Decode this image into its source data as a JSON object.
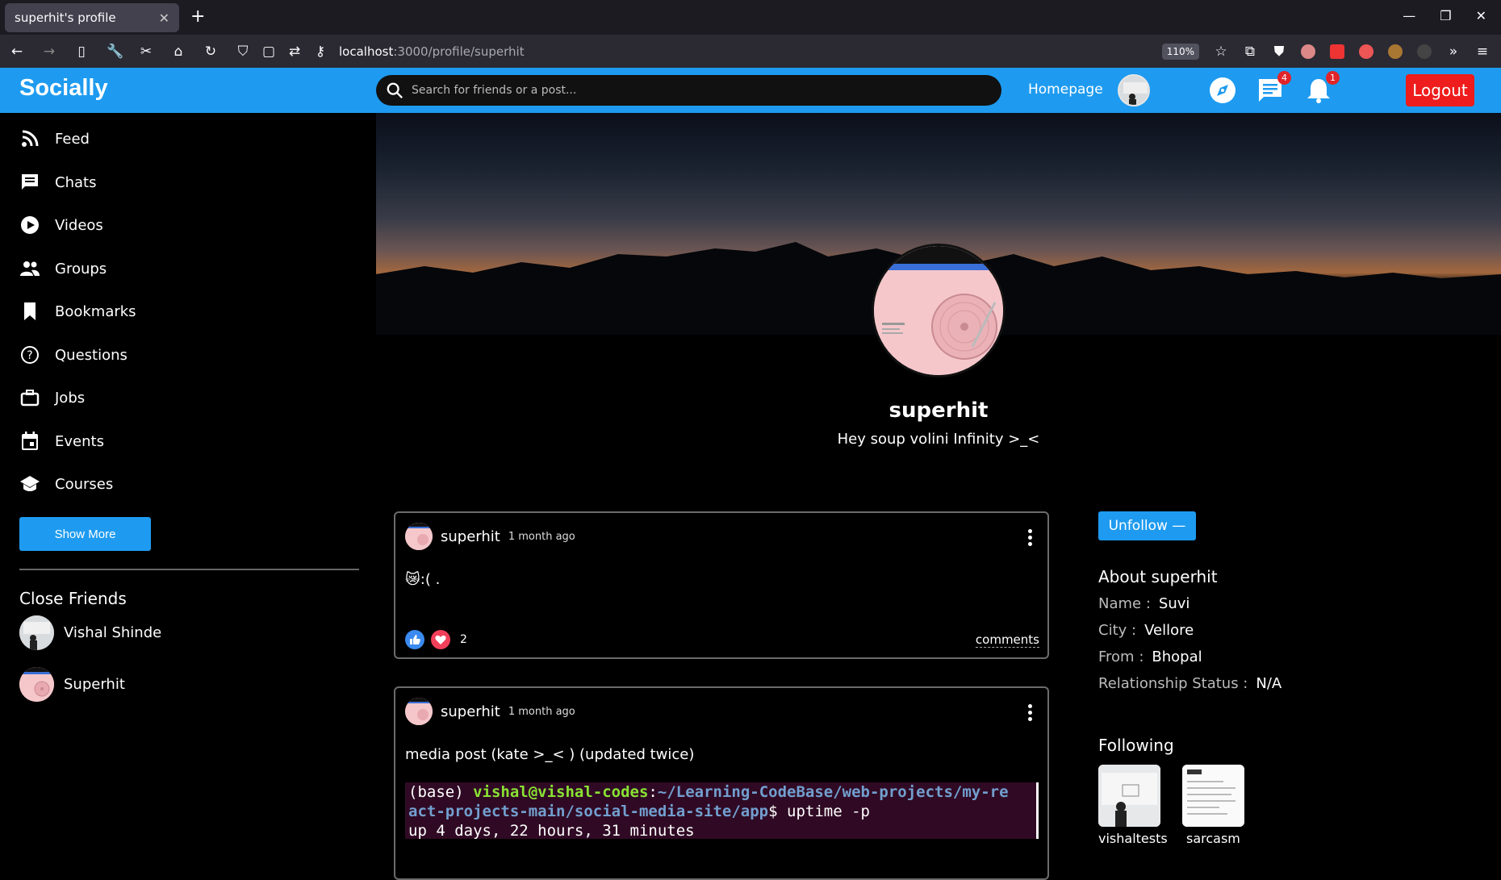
{
  "browser": {
    "tab_title": "superhit's profile",
    "url_host": "localhost",
    "url_path": ":3000/profile/superhit",
    "zoom": "110%"
  },
  "header": {
    "logo": "Socially",
    "search_placeholder": "Search for friends or a post...",
    "homepage_label": "Homepage",
    "messages_badge": "4",
    "notifications_badge": "1",
    "logout_label": "Logout"
  },
  "sidebar": {
    "items": [
      {
        "label": "Feed",
        "icon": "rss-icon"
      },
      {
        "label": "Chats",
        "icon": "chat-icon"
      },
      {
        "label": "Videos",
        "icon": "play-icon"
      },
      {
        "label": "Groups",
        "icon": "groups-icon"
      },
      {
        "label": "Bookmarks",
        "icon": "bookmark-icon"
      },
      {
        "label": "Questions",
        "icon": "help-icon"
      },
      {
        "label": "Jobs",
        "icon": "briefcase-icon"
      },
      {
        "label": "Events",
        "icon": "calendar-icon"
      },
      {
        "label": "Courses",
        "icon": "school-icon"
      }
    ],
    "show_more_label": "Show More",
    "close_friends_title": "Close Friends",
    "close_friends": [
      {
        "name": "Vishal Shinde"
      },
      {
        "name": "Superhit"
      }
    ]
  },
  "profile": {
    "username": "superhit",
    "bio": "Hey soup volini Infinity >_<"
  },
  "posts": [
    {
      "username": "superhit",
      "time": "1 month ago",
      "text": ":( .",
      "reaction_count": "2",
      "comments_label": "comments"
    },
    {
      "username": "superhit",
      "time": "1 month ago",
      "text": "media post (kate >_< ) (updated twice)",
      "terminal": {
        "prefix": "(base) ",
        "user": "vishal@vishal-codes",
        "colon": ":",
        "path_line1": "~/Learning-CodeBase/web-projects/my-re",
        "path_line2": "act-projects-main/social-media-site/app",
        "command": "$ uptime -p",
        "output": "up 4 days, 22 hours, 31 minutes"
      }
    }
  ],
  "about": {
    "follow_button": "Unfollow —",
    "title": "About superhit",
    "rows": [
      {
        "key": "Name :",
        "value": "Suvi"
      },
      {
        "key": "City :",
        "value": "Vellore"
      },
      {
        "key": "From :",
        "value": "Bhopal"
      },
      {
        "key": "Relationship Status :",
        "value": "N/A"
      }
    ],
    "following_title": "Following",
    "following": [
      {
        "name": "vishaltests"
      },
      {
        "name": "sarcasm"
      }
    ]
  },
  "colors": {
    "accent": "#1e9bf0",
    "logout": "#ee1c1c",
    "badge": "#e0242a"
  }
}
